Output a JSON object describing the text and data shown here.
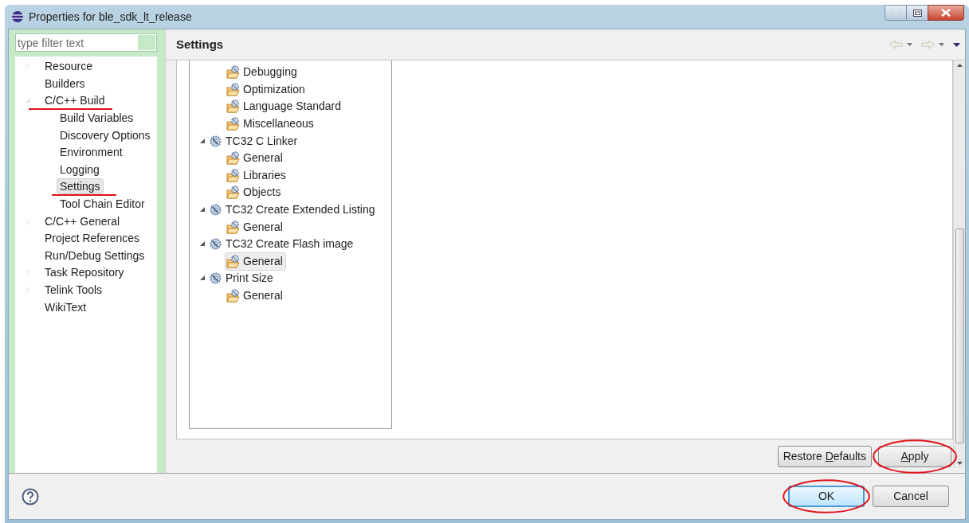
{
  "window": {
    "title": "Properties for ble_sdk_lt_release"
  },
  "filter": {
    "placeholder": "type filter text"
  },
  "nav_tree": [
    {
      "label": "Resource",
      "kind": "collapsed",
      "selected": false
    },
    {
      "label": "Builders",
      "kind": "leaf",
      "selected": false
    },
    {
      "label": "C/C++ Build",
      "kind": "expanded",
      "selected": false,
      "marked": true,
      "children": [
        {
          "label": "Build Variables",
          "selected": false
        },
        {
          "label": "Discovery Options",
          "selected": false
        },
        {
          "label": "Environment",
          "selected": false
        },
        {
          "label": "Logging",
          "selected": false
        },
        {
          "label": "Settings",
          "selected": true,
          "marked": true
        },
        {
          "label": "Tool Chain Editor",
          "selected": false
        }
      ]
    },
    {
      "label": "C/C++ General",
      "kind": "collapsed",
      "selected": false
    },
    {
      "label": "Project References",
      "kind": "leaf",
      "selected": false
    },
    {
      "label": "Run/Debug Settings",
      "kind": "leaf",
      "selected": false
    },
    {
      "label": "Task Repository",
      "kind": "collapsed",
      "selected": false
    },
    {
      "label": "Telink Tools",
      "kind": "collapsed",
      "selected": false
    },
    {
      "label": "WikiText",
      "kind": "leaf",
      "selected": false
    }
  ],
  "page": {
    "title": "Settings"
  },
  "settings_tree": [
    {
      "kind": "option",
      "label": "Debugging",
      "selected": false
    },
    {
      "kind": "option",
      "label": "Optimization",
      "selected": false
    },
    {
      "kind": "option",
      "label": "Language Standard",
      "selected": false
    },
    {
      "kind": "option",
      "label": "Miscellaneous",
      "selected": false
    },
    {
      "kind": "tool",
      "label": "TC32 C Linker",
      "expanded": true,
      "children": [
        {
          "kind": "option",
          "label": "General",
          "selected": false
        },
        {
          "kind": "option",
          "label": "Libraries",
          "selected": false
        },
        {
          "kind": "option",
          "label": "Objects",
          "selected": false
        }
      ]
    },
    {
      "kind": "tool",
      "label": "TC32 Create Extended Listing",
      "expanded": true,
      "children": [
        {
          "kind": "option",
          "label": "General",
          "selected": false
        }
      ]
    },
    {
      "kind": "tool",
      "label": "TC32 Create Flash image",
      "expanded": true,
      "children": [
        {
          "kind": "option",
          "label": "General",
          "selected": true
        }
      ]
    },
    {
      "kind": "tool",
      "label": "Print Size",
      "expanded": true,
      "children": [
        {
          "kind": "option",
          "label": "General",
          "selected": false
        }
      ]
    }
  ],
  "page_buttons": [
    {
      "label_parts": [
        {
          "text": "Restore ",
          "underlined": false
        },
        {
          "text": "D",
          "underlined": true
        },
        {
          "text": "efaults",
          "underlined": false
        }
      ],
      "marked": false
    },
    {
      "label_parts": [
        {
          "text": "A",
          "underlined": true
        },
        {
          "text": "pply",
          "underlined": false
        }
      ],
      "marked": true
    }
  ],
  "dialog_buttons": [
    {
      "label": "OK",
      "default": true,
      "marked": true
    },
    {
      "label": "Cancel",
      "default": false,
      "marked": false
    }
  ]
}
